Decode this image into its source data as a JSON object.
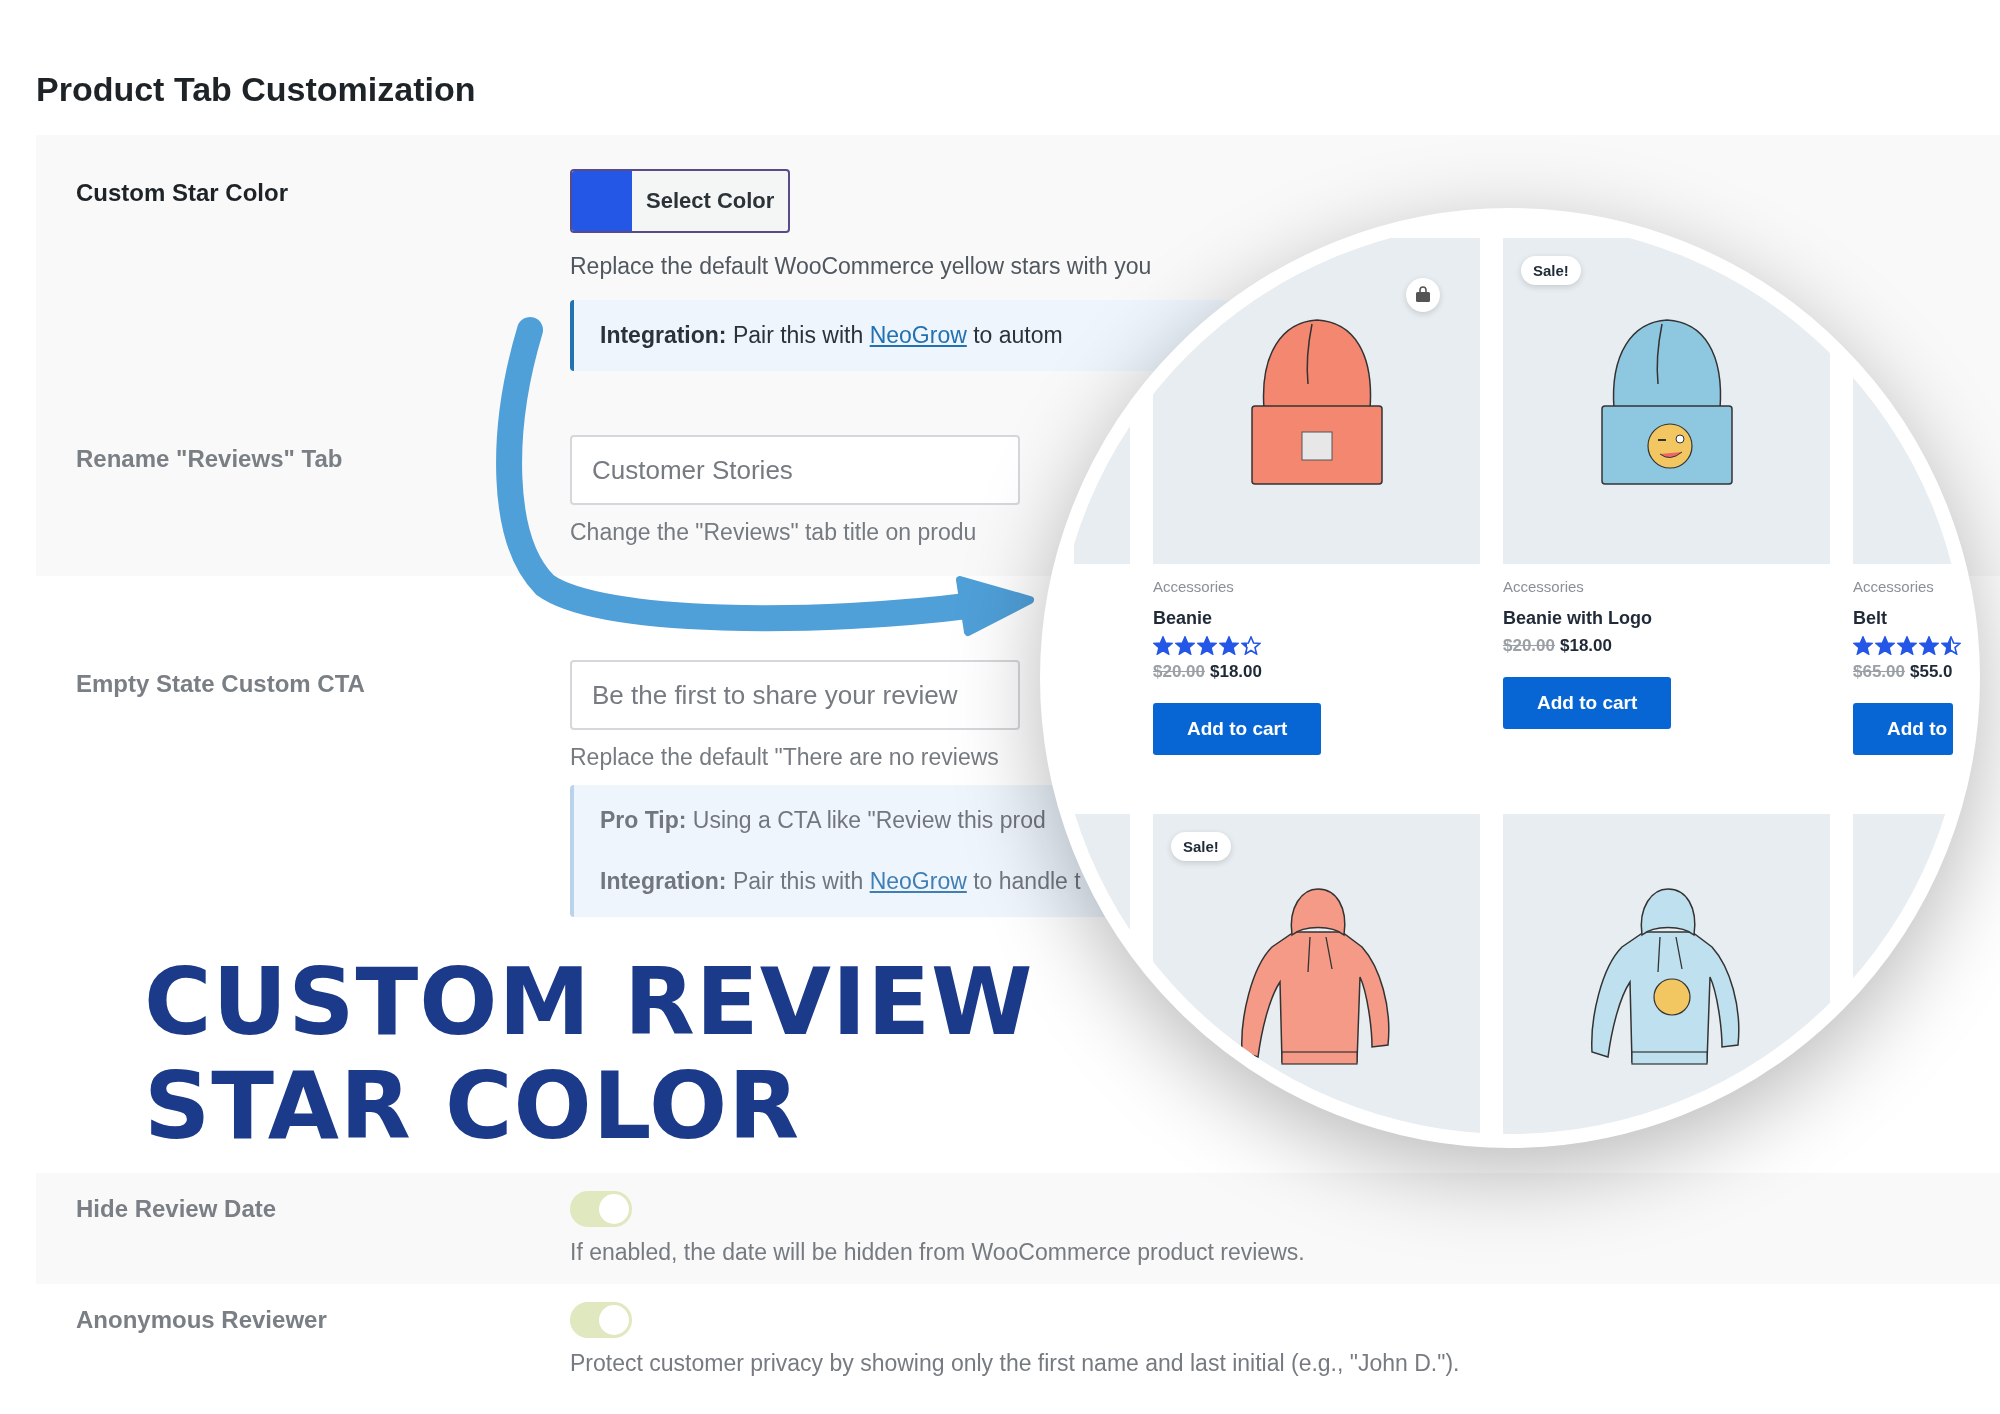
{
  "page": {
    "title": "Product Tab Customization"
  },
  "settings": [
    {
      "kind": "color",
      "label": "Custom Star Color",
      "button": "Select Color",
      "color": "#2557e6",
      "hint": "Replace the default WooCommerce yellow stars with you",
      "notes": [
        {
          "lead": "Integration:",
          "text": "Pair this with",
          "link": "NeoGrow",
          "after": "to autom"
        }
      ],
      "faded": false
    },
    {
      "kind": "text",
      "label": "Rename \"Reviews\" Tab",
      "value": "Customer Stories",
      "hint": "Change the \"Reviews\" tab title on produ",
      "faded": true
    },
    {
      "kind": "text",
      "label": "Empty State Custom CTA",
      "value": "Be the first to share your review",
      "hint": "Replace the default \"There are no reviews",
      "notes": [
        {
          "lead": "Pro Tip:",
          "text": "Using a CTA like \"Review this prod"
        },
        {
          "lead": "Integration:",
          "text": "Pair this with",
          "link": "NeoGrow",
          "after": "to handle t"
        }
      ],
      "faded": true
    },
    {
      "kind": "toggle",
      "label": "Hide Review Date",
      "on": true,
      "hint": "If enabled, the date will be hidden from WooCommerce product reviews.",
      "faded": true
    },
    {
      "kind": "toggle",
      "label": "Anonymous Reviewer",
      "on": true,
      "hint": "Protect customer privacy by showing only the first name and last initial (e.g., \"John D.\").",
      "faded": true
    }
  ],
  "headline": [
    "CUSTOM REVIEW",
    "STAR COLOR"
  ],
  "products": [
    {
      "kind": "blank"
    },
    {
      "kind": "beanie",
      "logo": false,
      "bag": true,
      "sale": false,
      "category": "Accessories",
      "name": "Beanie",
      "stars": 4.3,
      "old_price": "$20.00",
      "price": "$18.00",
      "button": "Add to cart"
    },
    {
      "kind": "beanie",
      "logo": true,
      "bag": false,
      "sale": true,
      "badge": "Sale!",
      "category": "Accessories",
      "name": "Beanie with Logo",
      "old_price": "$20.00",
      "price": "$18.00",
      "button": "Add to cart"
    },
    {
      "kind": "blank",
      "category": "Accessories",
      "name": "Belt",
      "stars": 4.5,
      "old_price": "$65.00",
      "price": "$55.0",
      "button": "Add to"
    },
    {
      "kind": "blank"
    },
    {
      "kind": "hoodie",
      "logo": false,
      "bag": false,
      "sale": true,
      "badge": "Sale!"
    },
    {
      "kind": "hoodie",
      "logo": true,
      "bag": false,
      "sale": false
    },
    {
      "kind": "blank"
    }
  ]
}
